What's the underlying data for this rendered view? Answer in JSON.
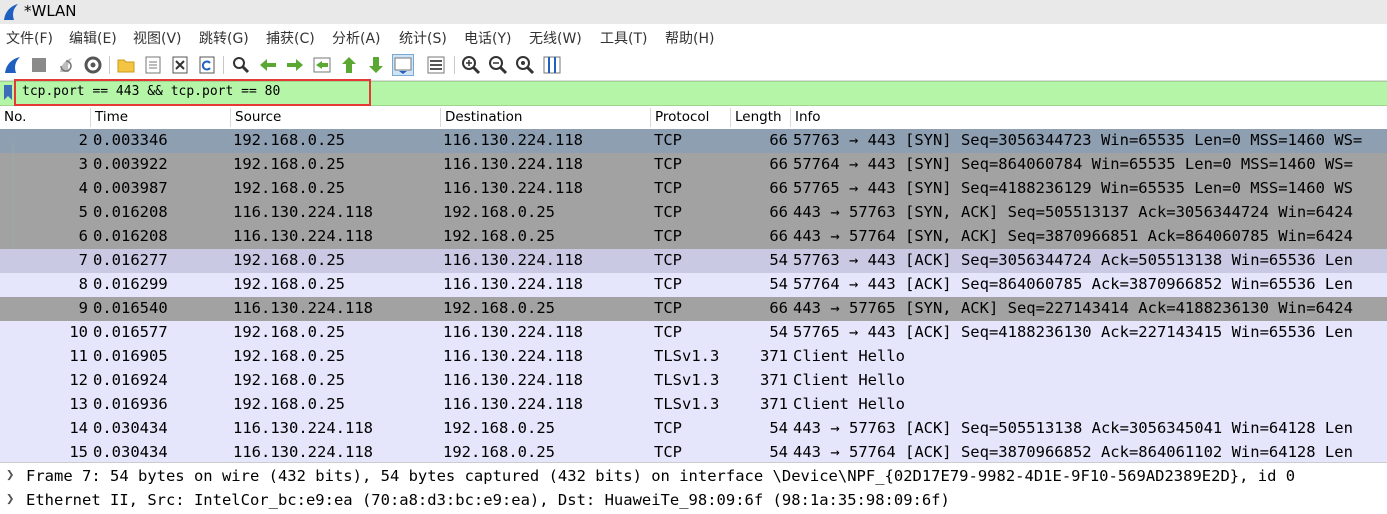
{
  "window": {
    "title": "*WLAN"
  },
  "menu": [
    "文件(F)",
    "编辑(E)",
    "视图(V)",
    "跳转(G)",
    "捕获(C)",
    "分析(A)",
    "统计(S)",
    "电话(Y)",
    "无线(W)",
    "工具(T)",
    "帮助(H)"
  ],
  "toolbar": {
    "buttons": [
      "start-capture-icon",
      "stop-capture-icon",
      "restart-capture-icon",
      "capture-options-icon",
      "open-file-icon",
      "save-file-icon",
      "close-file-icon",
      "reload-file-icon",
      "find-packet-icon",
      "go-back-icon",
      "go-forward-icon",
      "go-to-packet-icon",
      "go-first-icon",
      "go-last-icon",
      "auto-scroll-icon",
      "colorize-icon",
      "zoom-in-icon",
      "zoom-out-icon",
      "zoom-normal-icon",
      "resize-columns-icon"
    ]
  },
  "filter": {
    "text": "tcp.port == 443 && tcp.port == 80"
  },
  "columns": [
    "No.",
    "Time",
    "Source",
    "Destination",
    "Protocol",
    "Length",
    "Info"
  ],
  "colors": {
    "blue_row": "#8f9fb2",
    "gray_row": "#a2a2a2",
    "lavender_row": "#e5e5fb",
    "selected_row": "#c9c9e4",
    "filter_bg": "#b4f5a8",
    "highlight_box": "#e53935"
  },
  "packets": [
    {
      "no": "2",
      "time": "0.003346",
      "src": "192.168.0.25",
      "dst": "116.130.224.118",
      "proto": "TCP",
      "len": "66",
      "info": "57763 → 443 [SYN] Seq=3056344723 Win=65535 Len=0 MSS=1460 WS=",
      "style": "blue"
    },
    {
      "no": "3",
      "time": "0.003922",
      "src": "192.168.0.25",
      "dst": "116.130.224.118",
      "proto": "TCP",
      "len": "66",
      "info": "57764 → 443 [SYN] Seq=864060784 Win=65535 Len=0 MSS=1460 WS=",
      "style": "gray"
    },
    {
      "no": "4",
      "time": "0.003987",
      "src": "192.168.0.25",
      "dst": "116.130.224.118",
      "proto": "TCP",
      "len": "66",
      "info": "57765 → 443 [SYN] Seq=4188236129 Win=65535 Len=0 MSS=1460 WS",
      "style": "gray"
    },
    {
      "no": "5",
      "time": "0.016208",
      "src": "116.130.224.118",
      "dst": "192.168.0.25",
      "proto": "TCP",
      "len": "66",
      "info": "443 → 57763 [SYN, ACK] Seq=505513137 Ack=3056344724 Win=6424",
      "style": "gray"
    },
    {
      "no": "6",
      "time": "0.016208",
      "src": "116.130.224.118",
      "dst": "192.168.0.25",
      "proto": "TCP",
      "len": "66",
      "info": "443 → 57764 [SYN, ACK] Seq=3870966851 Ack=864060785 Win=6424",
      "style": "gray"
    },
    {
      "no": "7",
      "time": "0.016277",
      "src": "192.168.0.25",
      "dst": "116.130.224.118",
      "proto": "TCP",
      "len": "54",
      "info": "57763 → 443 [ACK] Seq=3056344724 Ack=505513138 Win=65536 Len",
      "style": "sel"
    },
    {
      "no": "8",
      "time": "0.016299",
      "src": "192.168.0.25",
      "dst": "116.130.224.118",
      "proto": "TCP",
      "len": "54",
      "info": "57764 → 443 [ACK] Seq=864060785 Ack=3870966852 Win=65536 Len",
      "style": "lav"
    },
    {
      "no": "9",
      "time": "0.016540",
      "src": "116.130.224.118",
      "dst": "192.168.0.25",
      "proto": "TCP",
      "len": "66",
      "info": "443 → 57765 [SYN, ACK] Seq=227143414 Ack=4188236130 Win=6424",
      "style": "gray"
    },
    {
      "no": "10",
      "time": "0.016577",
      "src": "192.168.0.25",
      "dst": "116.130.224.118",
      "proto": "TCP",
      "len": "54",
      "info": "57765 → 443 [ACK] Seq=4188236130 Ack=227143415 Win=65536 Len",
      "style": "lav"
    },
    {
      "no": "11",
      "time": "0.016905",
      "src": "192.168.0.25",
      "dst": "116.130.224.118",
      "proto": "TLSv1.3",
      "len": "371",
      "info": "Client Hello",
      "style": "lav"
    },
    {
      "no": "12",
      "time": "0.016924",
      "src": "192.168.0.25",
      "dst": "116.130.224.118",
      "proto": "TLSv1.3",
      "len": "371",
      "info": "Client Hello",
      "style": "lav"
    },
    {
      "no": "13",
      "time": "0.016936",
      "src": "192.168.0.25",
      "dst": "116.130.224.118",
      "proto": "TLSv1.3",
      "len": "371",
      "info": "Client Hello",
      "style": "lav"
    },
    {
      "no": "14",
      "time": "0.030434",
      "src": "116.130.224.118",
      "dst": "192.168.0.25",
      "proto": "TCP",
      "len": "54",
      "info": "443 → 57763 [ACK] Seq=505513138 Ack=3056345041 Win=64128 Len",
      "style": "lav"
    },
    {
      "no": "15",
      "time": "0.030434",
      "src": "116.130.224.118",
      "dst": "192.168.0.25",
      "proto": "TCP",
      "len": "54",
      "info": "443 → 57764 [ACK] Seq=3870966852 Ack=864061102 Win=64128 Len",
      "style": "lav"
    }
  ],
  "details": [
    "Frame 7: 54 bytes on wire (432 bits), 54 bytes captured (432 bits) on interface \\Device\\NPF_{02D17E79-9982-4D1E-9F10-569AD2389E2D}, id 0",
    "Ethernet II, Src: IntelCor_bc:e9:ea (70:a8:d3:bc:e9:ea), Dst: HuaweiTe_98:09:6f (98:1a:35:98:09:6f)"
  ]
}
